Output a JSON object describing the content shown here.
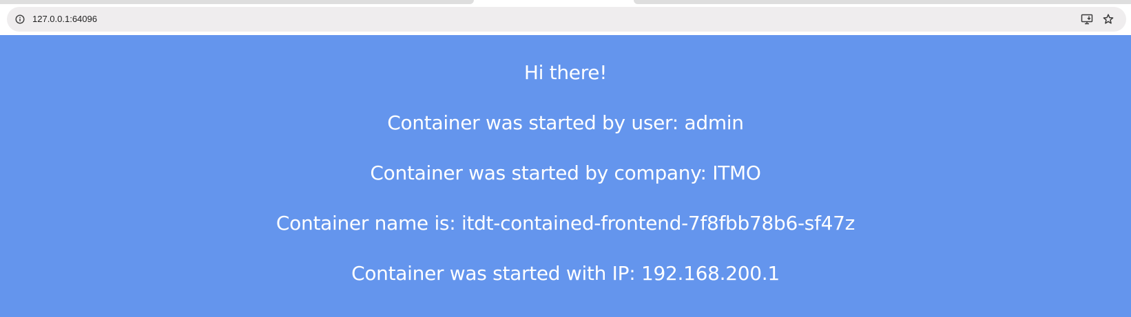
{
  "browser": {
    "url": "127.0.0.1:64096",
    "site_info_icon": "info-circle-icon",
    "install_icon": "install-app-icon",
    "bookmark_icon": "star-icon"
  },
  "page": {
    "background_color": "#6495ed",
    "text_color": "#ffffff",
    "greeting": "Hi there!",
    "started_by_user": "Container was started by user: admin",
    "started_by_company": "Container was started by company: ITMO",
    "container_name": "Container name is: itdt-contained-frontend-7f8fbb78b6-sf47z",
    "started_with_ip": "Container was started with IP: 192.168.200.1"
  }
}
